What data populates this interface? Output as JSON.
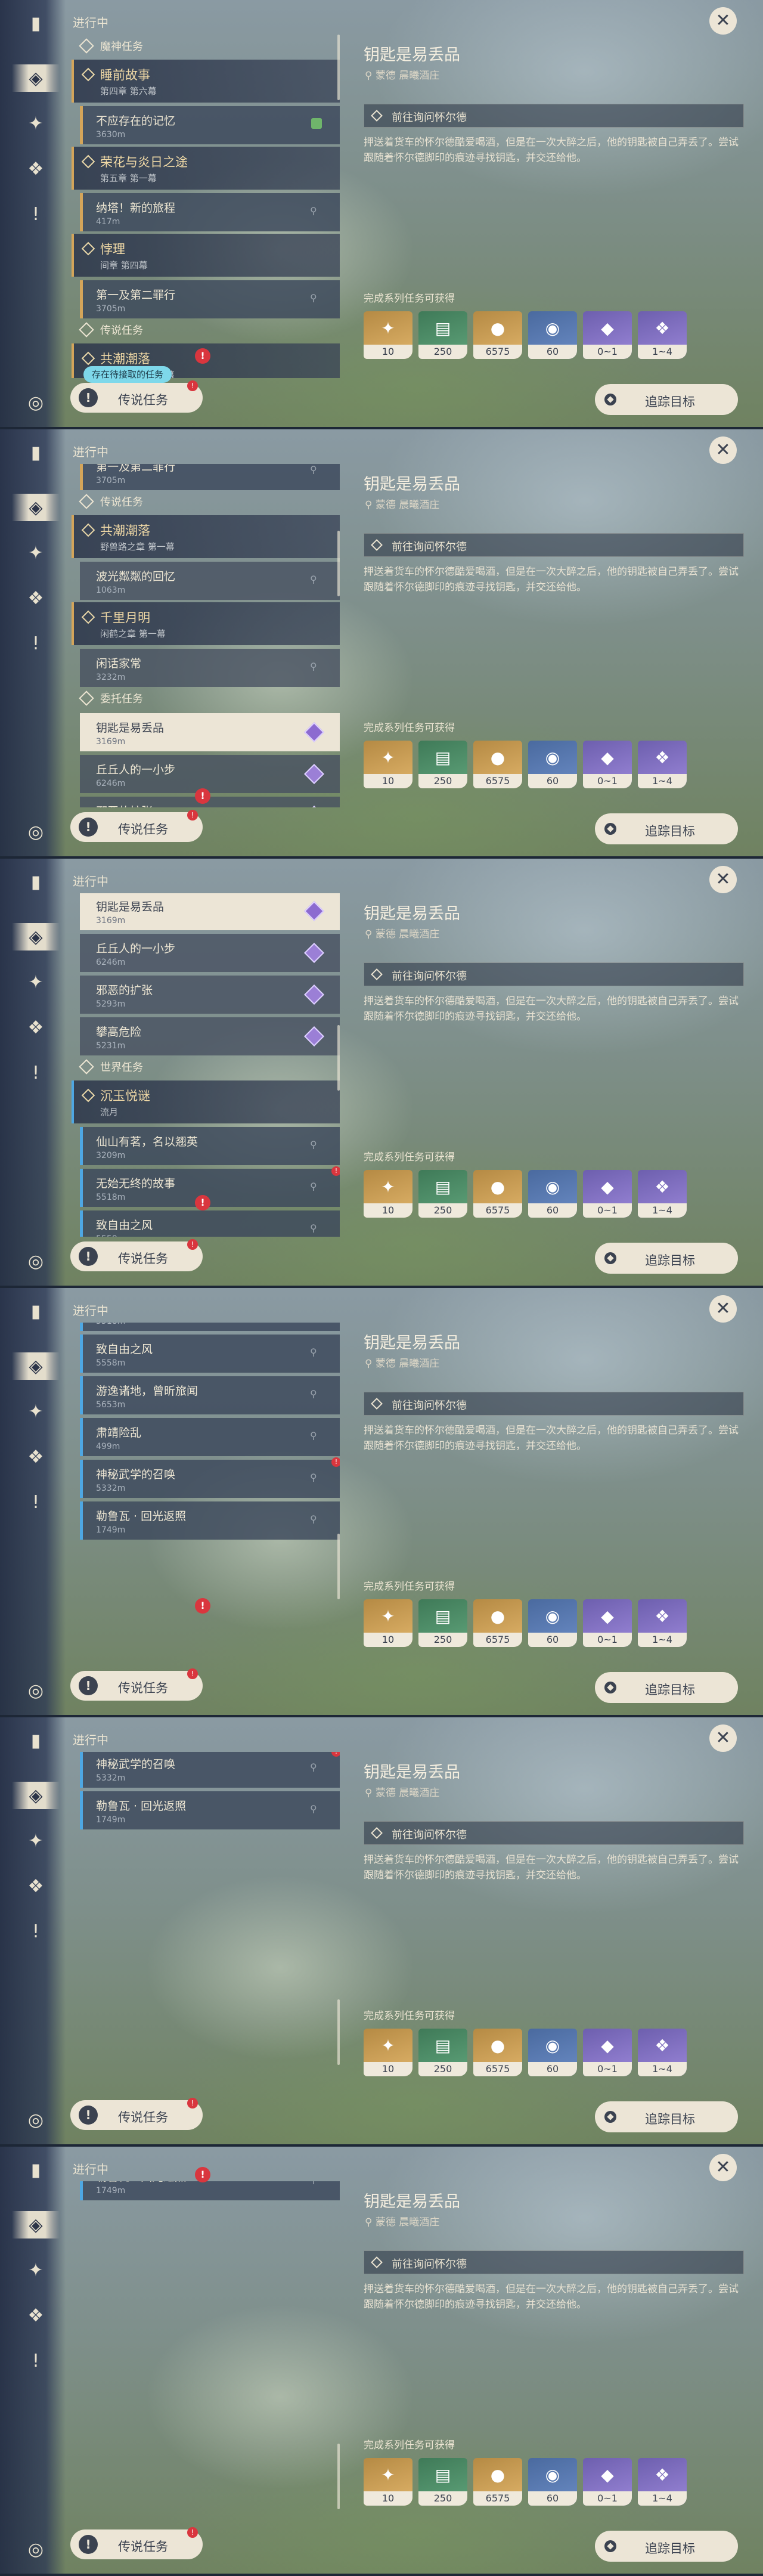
{
  "panel": {
    "status": "进行中",
    "pending_label": "存在待接取的任务",
    "legend_button": "传说任务",
    "legend_icon": "!",
    "badge": "!"
  },
  "detail": {
    "title": "钥匙是易丢品",
    "location": "蒙德 晨曦酒庄",
    "objective": "前往询问怀尔德",
    "description": "押送着货车的怀尔德酷爱喝酒，但是在一次大醉之后，他的钥匙被自己弄丢了。尝试跟随着怀尔德脚印的痕迹寻找钥匙，并交还给他。",
    "rewards_label": "完成系列任务可获得",
    "track_button": "追踪目标",
    "close": "✕",
    "pin_glyph": "⚲",
    "rewards": [
      {
        "count": "10",
        "icon": "primogem-icon",
        "theme": "r-exp"
      },
      {
        "count": "250",
        "icon": "adventure-exp-icon",
        "theme": "r-green"
      },
      {
        "count": "6575",
        "icon": "mora-icon",
        "theme": "r-exp"
      },
      {
        "count": "60",
        "icon": "companionship-exp-icon",
        "theme": "r-gold"
      },
      {
        "count": "0~1",
        "icon": "crystal-chunk-icon",
        "theme": "r-purple"
      },
      {
        "count": "1~4",
        "icon": "crystal-cluster-icon",
        "theme": "r-purple"
      }
    ]
  },
  "rail": [
    {
      "name": "quest-book-icon",
      "glyph": "▮"
    },
    {
      "name": "archon-quest-icon",
      "glyph": "◈"
    },
    {
      "name": "story-quest-icon",
      "glyph": "✦"
    },
    {
      "name": "commission-icon",
      "glyph": "❖"
    },
    {
      "name": "world-quest-icon",
      "glyph": "!"
    },
    {
      "name": "camera-icon",
      "glyph": "◎"
    }
  ],
  "quests": {
    "cat_archon": "魔神任务",
    "cat_legend": "传说任务",
    "cat_commission": "委托任务",
    "cat_world": "世界任务",
    "ch1_title": "睡前故事",
    "ch1_sub": "第四章 第六幕",
    "q1_name": "不应存在的记忆",
    "q1_dist": "3630m",
    "ch2_title": "荣花与炎日之途",
    "ch2_sub": "第五章 第一幕",
    "q2_name": "纳塔！新的旅程",
    "q2_dist": "417m",
    "ch3_title": "悖理",
    "ch3_sub": "间章 第四幕",
    "q3_name": "第一及第二罪行",
    "q3_dist": "3705m",
    "ch4_title": "共潮潮落",
    "ch4_sub": "野兽路之章 第一幕",
    "q4_name": "波光粼粼的回忆",
    "q4_dist": "1063m",
    "ch5_title": "千里月明",
    "ch5_sub": "闲鹤之章 第一幕",
    "q5_name": "闲话家常",
    "q5_dist": "3232m",
    "c1_name": "钥匙是易丢品",
    "c1_dist": "3169m",
    "c2_name": "丘丘人的一小步",
    "c2_dist": "6246m",
    "c3_name": "邪恶的扩张",
    "c3_dist": "5293m",
    "c4_name": "攀高危险",
    "c4_dist": "5231m",
    "ch6_title": "沉玉悦谜",
    "ch6_sub": "流月",
    "w1_name": "仙山有茗，名以翘英",
    "w1_dist": "3209m",
    "w2_name": "无始无终的故事",
    "w2_dist": "5518m",
    "w3_name": "致自由之风",
    "w3_dist": "5558m",
    "w4_name": "游逸诸地，曾昕旅闻",
    "w4_dist": "5653m",
    "w5_name": "肃靖险乱",
    "w5_dist": "499m",
    "w6_name": "神秘武学的召唤",
    "w6_dist": "5332m",
    "w7_name": "勒鲁瓦 · 回光返照",
    "w7_dist": "1749m"
  }
}
